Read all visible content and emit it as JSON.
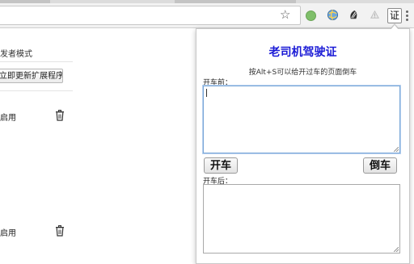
{
  "browser": {
    "star_icon": "☆",
    "extensions": [
      "green-dot-icon",
      "globe-icon",
      "dark-leaf-icon",
      "warning-icon",
      "cert-extension-icon"
    ],
    "cert_extension_label": "证"
  },
  "extensions_page": {
    "developer_mode_label": "发者模式",
    "update_button_label": "立即更新扩展程序",
    "item1_enabled_label": "启用",
    "item2_enabled_label": "启用"
  },
  "popup": {
    "title": "老司机驾驶证",
    "hint": "按Alt+S可以给开过车的页面倒车",
    "before_label": "开车前：",
    "before_value": "",
    "start_button": "开车",
    "reverse_button": "倒车",
    "after_label": "开车后：",
    "after_value": "",
    "colors": {
      "title": "#1a1ad6",
      "focus_border": "#7aa7d8"
    }
  }
}
